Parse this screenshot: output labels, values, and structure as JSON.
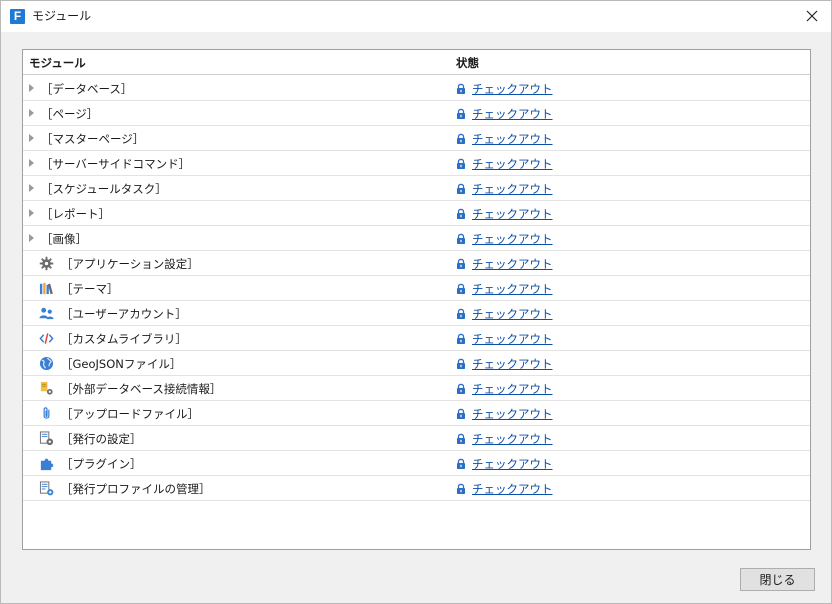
{
  "window": {
    "title": "モジュール",
    "logo_letter": "F"
  },
  "table": {
    "headers": {
      "module": "モジュール",
      "status": "状態"
    },
    "rows": [
      {
        "name": "［データベース］",
        "kind": "folder",
        "status": "チェックアウト"
      },
      {
        "name": "［ページ］",
        "kind": "folder",
        "status": "チェックアウト"
      },
      {
        "name": "［マスターページ］",
        "kind": "folder",
        "status": "チェックアウト"
      },
      {
        "name": "［サーバーサイドコマンド］",
        "kind": "folder",
        "status": "チェックアウト"
      },
      {
        "name": "［スケジュールタスク］",
        "kind": "folder",
        "status": "チェックアウト"
      },
      {
        "name": "［レポート］",
        "kind": "folder",
        "status": "チェックアウト"
      },
      {
        "name": "［画像］",
        "kind": "folder",
        "status": "チェックアウト"
      },
      {
        "name": "［アプリケーション設定］",
        "kind": "item",
        "icon": "gear-icon",
        "status": "チェックアウト"
      },
      {
        "name": "［テーマ］",
        "kind": "item",
        "icon": "theme-books-icon",
        "status": "チェックアウト"
      },
      {
        "name": "［ユーザーアカウント］",
        "kind": "item",
        "icon": "users-icon",
        "status": "チェックアウト"
      },
      {
        "name": "［カスタムライブラリ］",
        "kind": "item",
        "icon": "code-icon",
        "status": "チェックアウト"
      },
      {
        "name": "［GeoJSONファイル］",
        "kind": "item",
        "icon": "globe-icon",
        "status": "チェックアウト"
      },
      {
        "name": "［外部データベース接続情報］",
        "kind": "item",
        "icon": "db-connection-icon",
        "status": "チェックアウト"
      },
      {
        "name": "［アップロードファイル］",
        "kind": "item",
        "icon": "paperclip-icon",
        "status": "チェックアウト"
      },
      {
        "name": "［発行の設定］",
        "kind": "item",
        "icon": "publish-settings-icon",
        "status": "チェックアウト"
      },
      {
        "name": "［プラグイン］",
        "kind": "item",
        "icon": "puzzle-icon",
        "status": "チェックアウト"
      },
      {
        "name": "［発行プロファイルの管理］",
        "kind": "item",
        "icon": "publish-profile-icon",
        "status": "チェックアウト"
      }
    ]
  },
  "footer": {
    "close_label": "閉じる"
  },
  "colors": {
    "link": "#0b4fa8",
    "icon_blue": "#3b7fd4",
    "lock": "#2b6fc4"
  }
}
